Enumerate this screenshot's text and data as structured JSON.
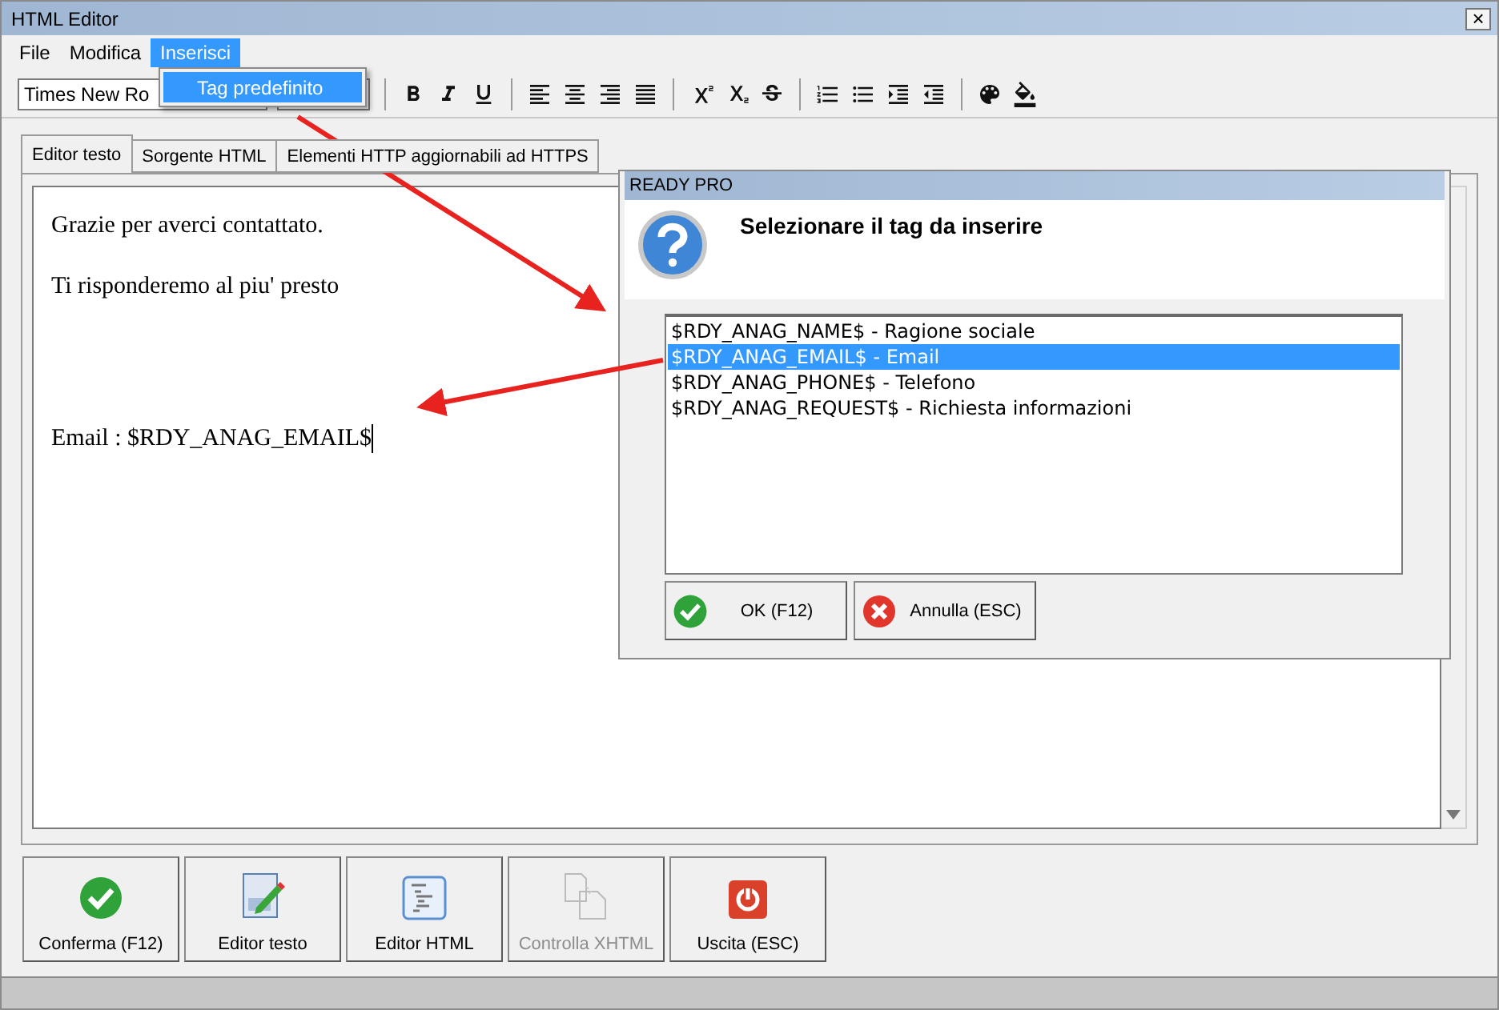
{
  "window": {
    "title": "HTML Editor",
    "close": "×"
  },
  "menu": [
    {
      "label": "File",
      "selected": false
    },
    {
      "label": "Modifica",
      "selected": false
    },
    {
      "label": "Inserisci",
      "selected": true
    }
  ],
  "open_menu": {
    "items": [
      {
        "label": "Tag predefinito",
        "selected": true
      }
    ]
  },
  "toolbar": {
    "font": "Times New Ro"
  },
  "tabs": [
    {
      "label": "Editor testo",
      "selected": true
    },
    {
      "label": "Sorgente HTML",
      "selected": false
    },
    {
      "label": "Elementi HTTP aggiornabili ad HTTPS",
      "selected": false
    }
  ],
  "editor": {
    "paragraphs": [
      {
        "text": "Grazie per averci contattato.",
        "cursor": false
      },
      {
        "text": "Ti risponderemo al piu' presto",
        "cursor": false
      },
      {
        "text": "Email : $RDY_ANAG_EMAIL$",
        "cursor": true
      }
    ]
  },
  "buttons": [
    {
      "label": "Conferma (F12)",
      "kind": "confirm",
      "disabled": false
    },
    {
      "label": "Editor testo",
      "kind": "edit",
      "disabled": false
    },
    {
      "label": "Editor HTML",
      "kind": "html",
      "disabled": false
    },
    {
      "label": "Controlla XHTML",
      "kind": "check",
      "disabled": true
    },
    {
      "label": "Uscita (ESC)",
      "kind": "exit",
      "disabled": false
    }
  ],
  "dialog": {
    "title": "READY PRO",
    "heading": "Selezionare il tag da inserire",
    "items": [
      {
        "label": "$RDY_ANAG_NAME$ - Ragione sociale",
        "selected": false
      },
      {
        "label": "$RDY_ANAG_EMAIL$ - Email",
        "selected": true
      },
      {
        "label": "$RDY_ANAG_PHONE$ - Telefono",
        "selected": false
      },
      {
        "label": "$RDY_ANAG_REQUEST$ - Richiesta informazioni",
        "selected": false
      }
    ],
    "buttons": [
      {
        "label": "OK (F12)",
        "kind": "ok"
      },
      {
        "label": "Annulla (ESC)",
        "kind": "cancel"
      }
    ]
  }
}
